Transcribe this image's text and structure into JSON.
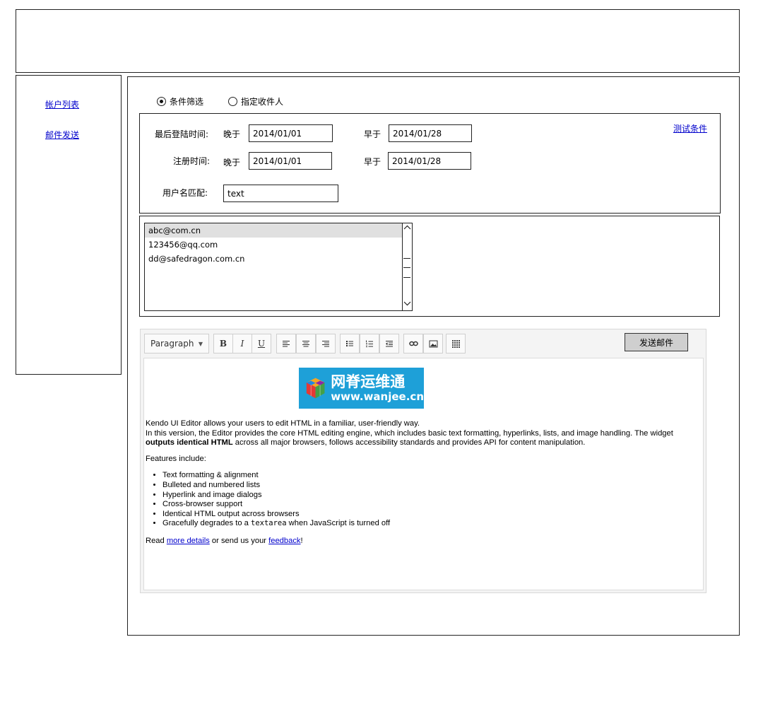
{
  "sidebar": {
    "items": [
      {
        "label": "帐户列表"
      },
      {
        "label": "邮件发送"
      }
    ]
  },
  "mode": {
    "options": [
      {
        "label": "条件筛选",
        "selected": true
      },
      {
        "label": "指定收件人",
        "selected": false
      }
    ]
  },
  "filter": {
    "test_link": "测试条件",
    "last_login_label": "最后登陆时间:",
    "register_label": "注册时间:",
    "username_label": "用户名匹配:",
    "after_label": "晚于",
    "before_label": "早于",
    "last_login_after": "2014/01/01",
    "last_login_before": "2014/01/28",
    "register_after": "2014/01/01",
    "register_before": "2014/01/28",
    "username_value": "text"
  },
  "recipients": {
    "items": [
      {
        "email": "abc@com.cn",
        "selected": true
      },
      {
        "email": "123456@qq.com",
        "selected": false
      },
      {
        "email": "dd@safedragon.com.cn",
        "selected": false
      }
    ]
  },
  "editor": {
    "format_select": "Paragraph",
    "send_label": "发送邮件",
    "logo": {
      "title": "网脊运维通",
      "url": "www.wanjee.cn"
    },
    "content": {
      "intro1": "Kendo UI Editor allows your users to edit HTML in a familiar, user-friendly way.",
      "intro2a": "In this version, the Editor provides the core HTML editing engine, which includes basic text formatting, hyperlinks, lists, and image handling. The widget ",
      "intro2_bold": "outputs identical HTML",
      "intro2b": " across all major browsers, follows accessibility standards and provides API for content manipulation.",
      "features_title": "Features include:",
      "features": [
        "Text formatting & alignment",
        "Bulleted and numbered lists",
        "Hyperlink and image dialogs",
        "Cross-browser support",
        "Identical HTML output across browsers"
      ],
      "last_feature_a": "Gracefully degrades to a ",
      "last_feature_code": "textarea",
      "last_feature_b": " when JavaScript is turned off",
      "read_a": "Read ",
      "read_link1": "more details",
      "read_b": " or send us your ",
      "read_link2": "feedback",
      "read_c": "!"
    }
  },
  "colors": {
    "link": "#0000cc",
    "logo_bg": "#1ea0d8",
    "selected_row": "#e0e0e0",
    "send_button": "#cfcfcf"
  }
}
